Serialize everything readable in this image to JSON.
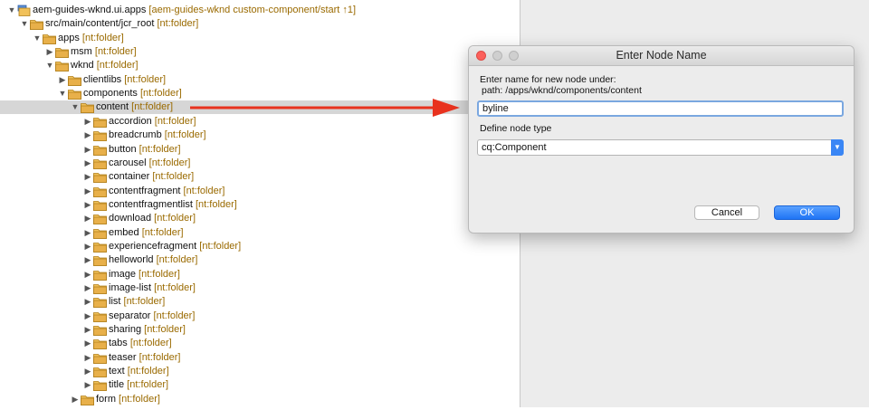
{
  "tree": {
    "rows": [
      {
        "depth": 0,
        "twisty": "open",
        "icon": "project",
        "label": "aem-guides-wknd.ui.apps",
        "nt": "",
        "decoration": "[aem-guides-wknd custom-component/start ↑1]"
      },
      {
        "depth": 1,
        "twisty": "open",
        "icon": "folder",
        "label": "src/main/content/jcr_root",
        "nt": "[nt:folder]"
      },
      {
        "depth": 2,
        "twisty": "open",
        "icon": "folder",
        "label": "apps",
        "nt": "[nt:folder]"
      },
      {
        "depth": 3,
        "twisty": "closed",
        "icon": "folder",
        "label": "msm",
        "nt": "[nt:folder]"
      },
      {
        "depth": 3,
        "twisty": "open",
        "icon": "folder",
        "label": "wknd",
        "nt": "[nt:folder]"
      },
      {
        "depth": 4,
        "twisty": "closed",
        "icon": "folder",
        "label": "clientlibs",
        "nt": "[nt:folder]"
      },
      {
        "depth": 4,
        "twisty": "open",
        "icon": "folder",
        "label": "components",
        "nt": "[nt:folder]"
      },
      {
        "depth": 5,
        "twisty": "open",
        "icon": "folder",
        "label": "content",
        "nt": "[nt:folder]",
        "selected": true
      },
      {
        "depth": 6,
        "twisty": "closed",
        "icon": "folder",
        "label": "accordion",
        "nt": "[nt:folder]"
      },
      {
        "depth": 6,
        "twisty": "closed",
        "icon": "folder",
        "label": "breadcrumb",
        "nt": "[nt:folder]"
      },
      {
        "depth": 6,
        "twisty": "closed",
        "icon": "folder",
        "label": "button",
        "nt": "[nt:folder]"
      },
      {
        "depth": 6,
        "twisty": "closed",
        "icon": "folder",
        "label": "carousel",
        "nt": "[nt:folder]"
      },
      {
        "depth": 6,
        "twisty": "closed",
        "icon": "folder",
        "label": "container",
        "nt": "[nt:folder]"
      },
      {
        "depth": 6,
        "twisty": "closed",
        "icon": "folder",
        "label": "contentfragment",
        "nt": "[nt:folder]"
      },
      {
        "depth": 6,
        "twisty": "closed",
        "icon": "folder",
        "label": "contentfragmentlist",
        "nt": "[nt:folder]"
      },
      {
        "depth": 6,
        "twisty": "closed",
        "icon": "folder",
        "label": "download",
        "nt": "[nt:folder]"
      },
      {
        "depth": 6,
        "twisty": "closed",
        "icon": "folder",
        "label": "embed",
        "nt": "[nt:folder]"
      },
      {
        "depth": 6,
        "twisty": "closed",
        "icon": "folder",
        "label": "experiencefragment",
        "nt": "[nt:folder]"
      },
      {
        "depth": 6,
        "twisty": "closed",
        "icon": "folder",
        "label": "helloworld",
        "nt": "[nt:folder]"
      },
      {
        "depth": 6,
        "twisty": "closed",
        "icon": "folder",
        "label": "image",
        "nt": "[nt:folder]"
      },
      {
        "depth": 6,
        "twisty": "closed",
        "icon": "folder",
        "label": "image-list",
        "nt": "[nt:folder]"
      },
      {
        "depth": 6,
        "twisty": "closed",
        "icon": "folder",
        "label": "list",
        "nt": "[nt:folder]"
      },
      {
        "depth": 6,
        "twisty": "closed",
        "icon": "folder",
        "label": "separator",
        "nt": "[nt:folder]"
      },
      {
        "depth": 6,
        "twisty": "closed",
        "icon": "folder",
        "label": "sharing",
        "nt": "[nt:folder]"
      },
      {
        "depth": 6,
        "twisty": "closed",
        "icon": "folder",
        "label": "tabs",
        "nt": "[nt:folder]"
      },
      {
        "depth": 6,
        "twisty": "closed",
        "icon": "folder",
        "label": "teaser",
        "nt": "[nt:folder]"
      },
      {
        "depth": 6,
        "twisty": "closed",
        "icon": "folder",
        "label": "text",
        "nt": "[nt:folder]"
      },
      {
        "depth": 6,
        "twisty": "closed",
        "icon": "folder",
        "label": "title",
        "nt": "[nt:folder]"
      },
      {
        "depth": 5,
        "twisty": "closed",
        "icon": "folder",
        "label": "form",
        "nt": "[nt:folder]"
      }
    ]
  },
  "annotation": {
    "arrow_color": "#e8321e",
    "icon": "red-arrow-icon"
  },
  "dialog": {
    "title": "Enter Node Name",
    "prompt": "Enter name for new node under:",
    "path_line": "path: /apps/wknd/components/content",
    "name_value": "byline",
    "type_label": "Define node type",
    "type_value": "cq:Component",
    "cancel_label": "Cancel",
    "ok_label": "OK"
  },
  "colors": {
    "accent": "#2f7cf6",
    "nt_text": "#9a6a00",
    "folder": "#e8b04a"
  }
}
